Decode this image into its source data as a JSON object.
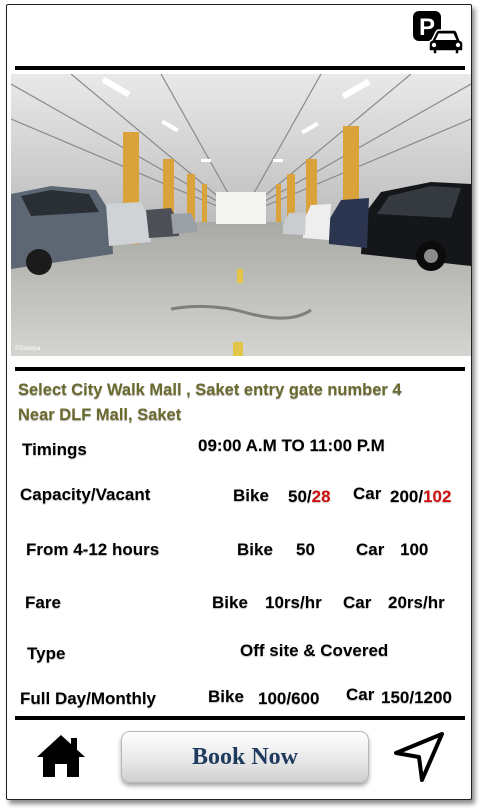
{
  "address": {
    "line1": "Select City Walk Mall , Saket entry gate number 4",
    "line2": "Near DLF Mall, Saket"
  },
  "photo": {
    "credit": "©Sebepa"
  },
  "timings": {
    "label": "Timings",
    "value": "09:00 A.M  TO  11:00 P.M"
  },
  "capacity": {
    "label": "Capacity/Vacant",
    "bike_label": "Bike",
    "bike_total": "50/",
    "bike_vacant": "28",
    "car_label": "Car",
    "car_total": "200/",
    "car_vacant": "102"
  },
  "hours": {
    "label": "From 4-12 hours",
    "bike_label": "Bike",
    "bike_value": "50",
    "car_label": "Car",
    "car_value": "100"
  },
  "fare": {
    "label": "Fare",
    "bike_label": "Bike",
    "bike_value": "10rs/hr",
    "car_label": "Car",
    "car_value": "20rs/hr"
  },
  "type": {
    "label": "Type",
    "value": "Off site & Covered"
  },
  "fullday": {
    "label": "Full Day/Monthly",
    "bike_label": "Bike",
    "bike_value": "100/600",
    "car_label": "Car",
    "car_value": "150/1200"
  },
  "footer": {
    "book_label": "Book Now"
  },
  "icons": {
    "logo": "parking-car-icon",
    "home": "home-icon",
    "nav": "navigation-arrow-icon"
  },
  "colors": {
    "address": "#6b6a2e",
    "vacant": "#d01010",
    "book_text": "#1f3a5f"
  }
}
